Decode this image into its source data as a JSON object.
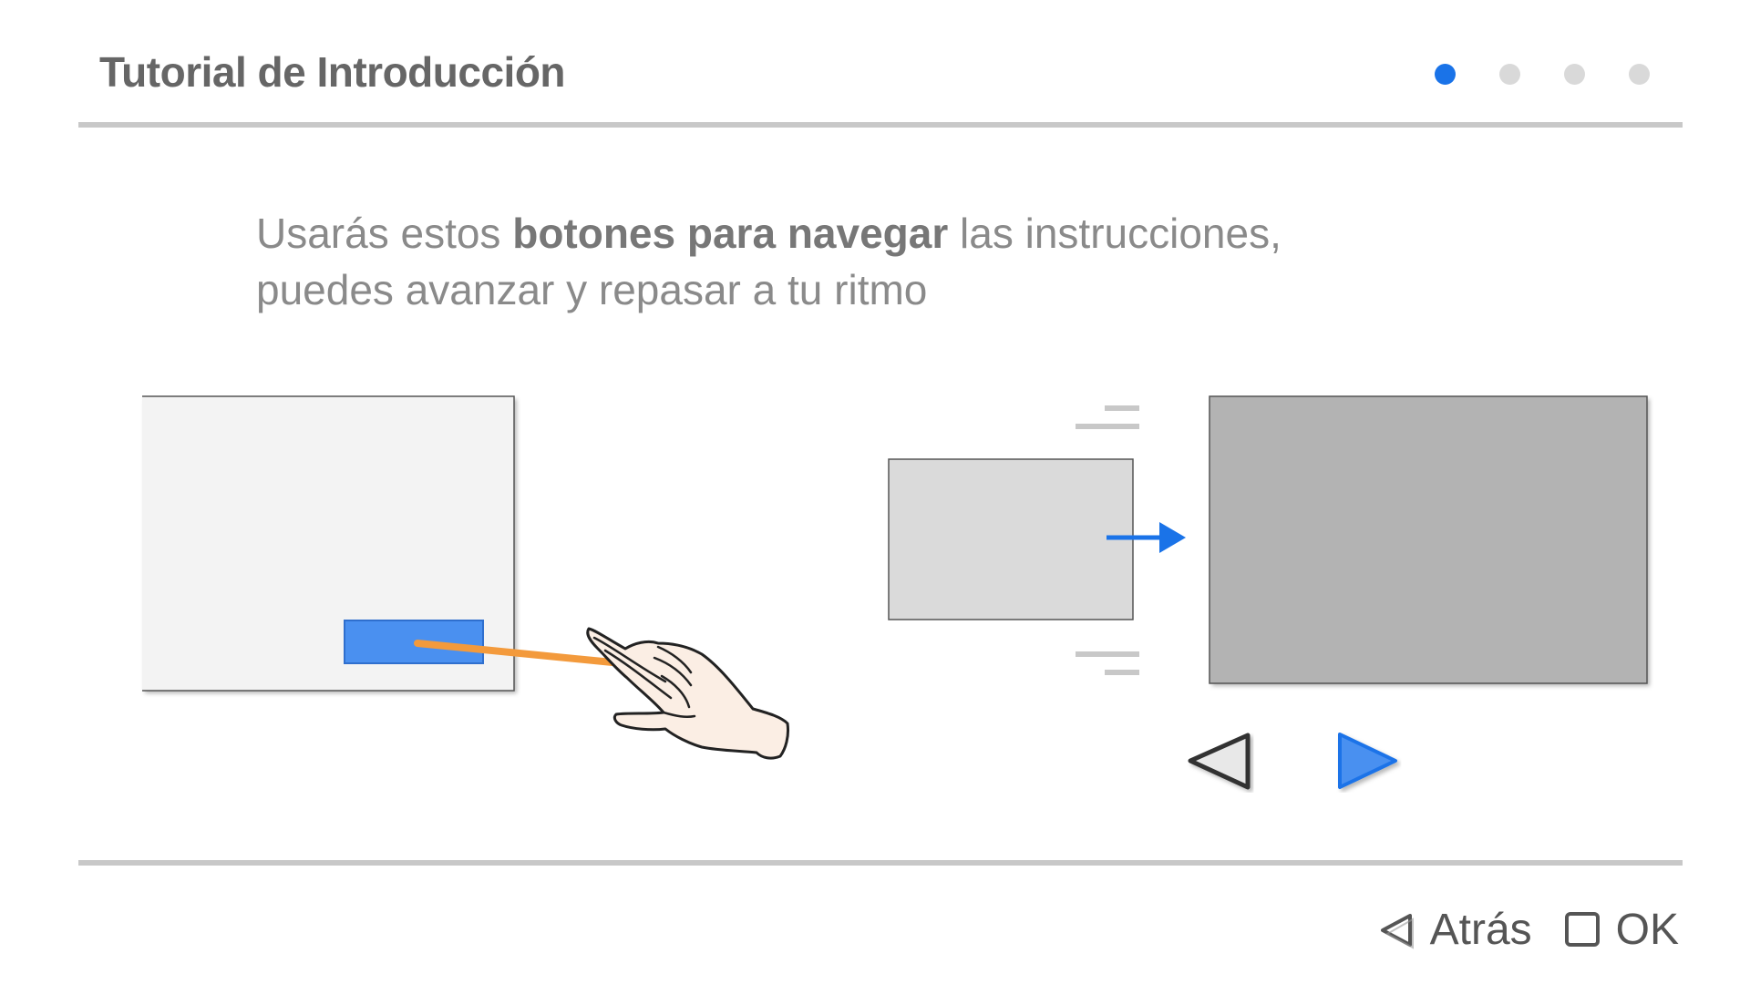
{
  "header": {
    "title": "Tutorial de Introducción",
    "pages": [
      {
        "label": "page-1",
        "active": true
      },
      {
        "label": "page-2",
        "active": false
      },
      {
        "label": "page-3",
        "active": false
      },
      {
        "label": "page-4",
        "active": false
      }
    ]
  },
  "instruction": {
    "part1": "Usarás estos ",
    "bold": "botones para navegar",
    "part2": " las instrucciones,",
    "line2": "puedes avanzar y repasar a tu ritmo"
  },
  "footer": {
    "back_label": "Atrás",
    "ok_label": "OK"
  },
  "icons": {
    "back": "triangle-left-icon",
    "ok": "square-icon",
    "prev": "prev-triangle-icon",
    "next": "next-triangle-icon",
    "hand": "pointing-hand-icon"
  },
  "colors": {
    "accent": "#1a73e8",
    "button_blue": "#4a90f0",
    "pointer_line": "#f39a3c",
    "title": "#666666",
    "text": "#8a8a8a"
  }
}
